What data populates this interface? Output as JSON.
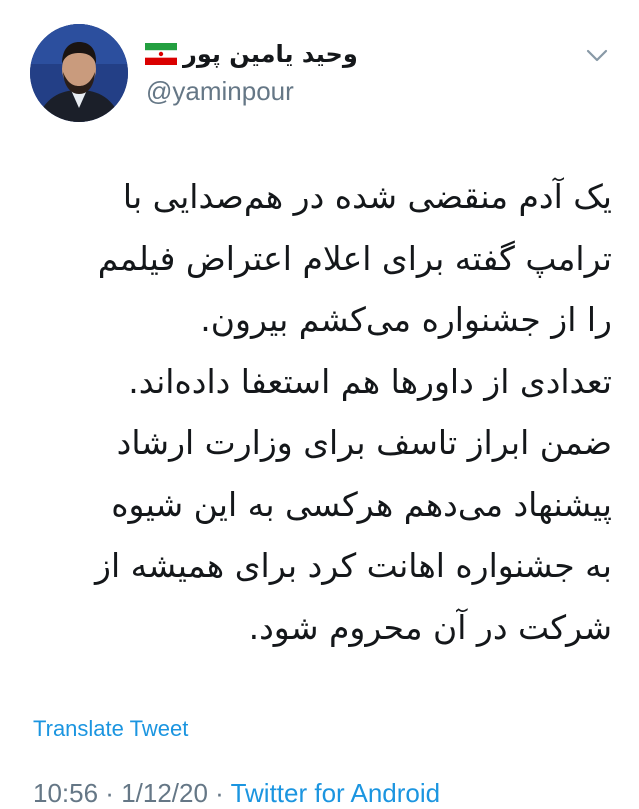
{
  "profile": {
    "display_name": "وحید یامین پور",
    "handle": "@yaminpour",
    "avatar_icon": "profile-photo",
    "flag_icon": "iran-flag-icon"
  },
  "menu_icon": "chevron-down-icon",
  "tweet": {
    "lines": [
      "یک آدم منقضی شده در هم‌صدایی با",
      "ترامپ گفته برای اعلام اعتراض فیلمم",
      "را از جشنواره می‌کشم بیرون.",
      "تعدادی از داورها هم استعفا داده‌اند.",
      "ضمن ابراز تاسف برای وزارت ارشاد",
      "پیشنهاد می‌دهم هرکسی به این شیوه",
      "به جشنواره اهانت کرد برای همیشه از",
      "شرکت در آن محروم شود."
    ]
  },
  "translate_label": "Translate Tweet",
  "meta": {
    "time": "10:56",
    "separator1": " · ",
    "date": "1/12/20",
    "separator2": " · ",
    "source": "Twitter for Android"
  },
  "colors": {
    "link": "#1b95e0",
    "secondary": "#657786",
    "text": "#14171a"
  }
}
